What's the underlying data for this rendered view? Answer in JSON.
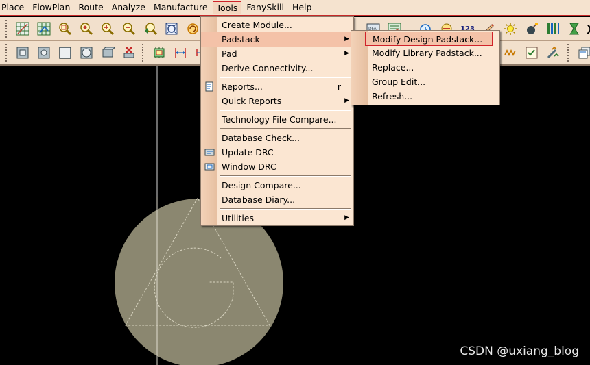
{
  "menubar": {
    "items": [
      {
        "label": "Place"
      },
      {
        "label": "FlowPlan"
      },
      {
        "label": "Route"
      },
      {
        "label": "Analyze"
      },
      {
        "label": "Manufacture"
      },
      {
        "label": "Tools"
      },
      {
        "label": "FanySkill"
      },
      {
        "label": "Help"
      }
    ]
  },
  "toolbar_top": {
    "label_123": "123",
    "label_dfa": "DFA"
  },
  "tools_menu": {
    "create_module": "Create Module...",
    "padstack": "Padstack",
    "pad": "Pad",
    "derive_connectivity": "Derive Connectivity...",
    "reports": "Reports...",
    "reports_shortcut": "r",
    "quick_reports": "Quick Reports",
    "technology_file_compare": "Technology File Compare...",
    "database_check": "Database Check...",
    "update_drc": "Update DRC",
    "window_drc": "Window DRC",
    "design_compare": "Design Compare...",
    "database_diary": "Database Diary...",
    "utilities": "Utilities"
  },
  "padstack_menu": {
    "modify_design_padstack": "Modify Design Padstack...",
    "modify_library_padstack": "Modify Library Padstack...",
    "replace": "Replace...",
    "group_edit": "Group Edit...",
    "refresh": "Refresh..."
  },
  "watermark": "CSDN @uxiang_blog",
  "colors": {
    "menubar_bg": "#f5e3cf",
    "menu_bg": "#fbe6d2",
    "highlight": "#f4c2a8",
    "accent_red": "#d0222a",
    "canvas_bg": "#000000",
    "pad_fill": "#8b8770"
  }
}
